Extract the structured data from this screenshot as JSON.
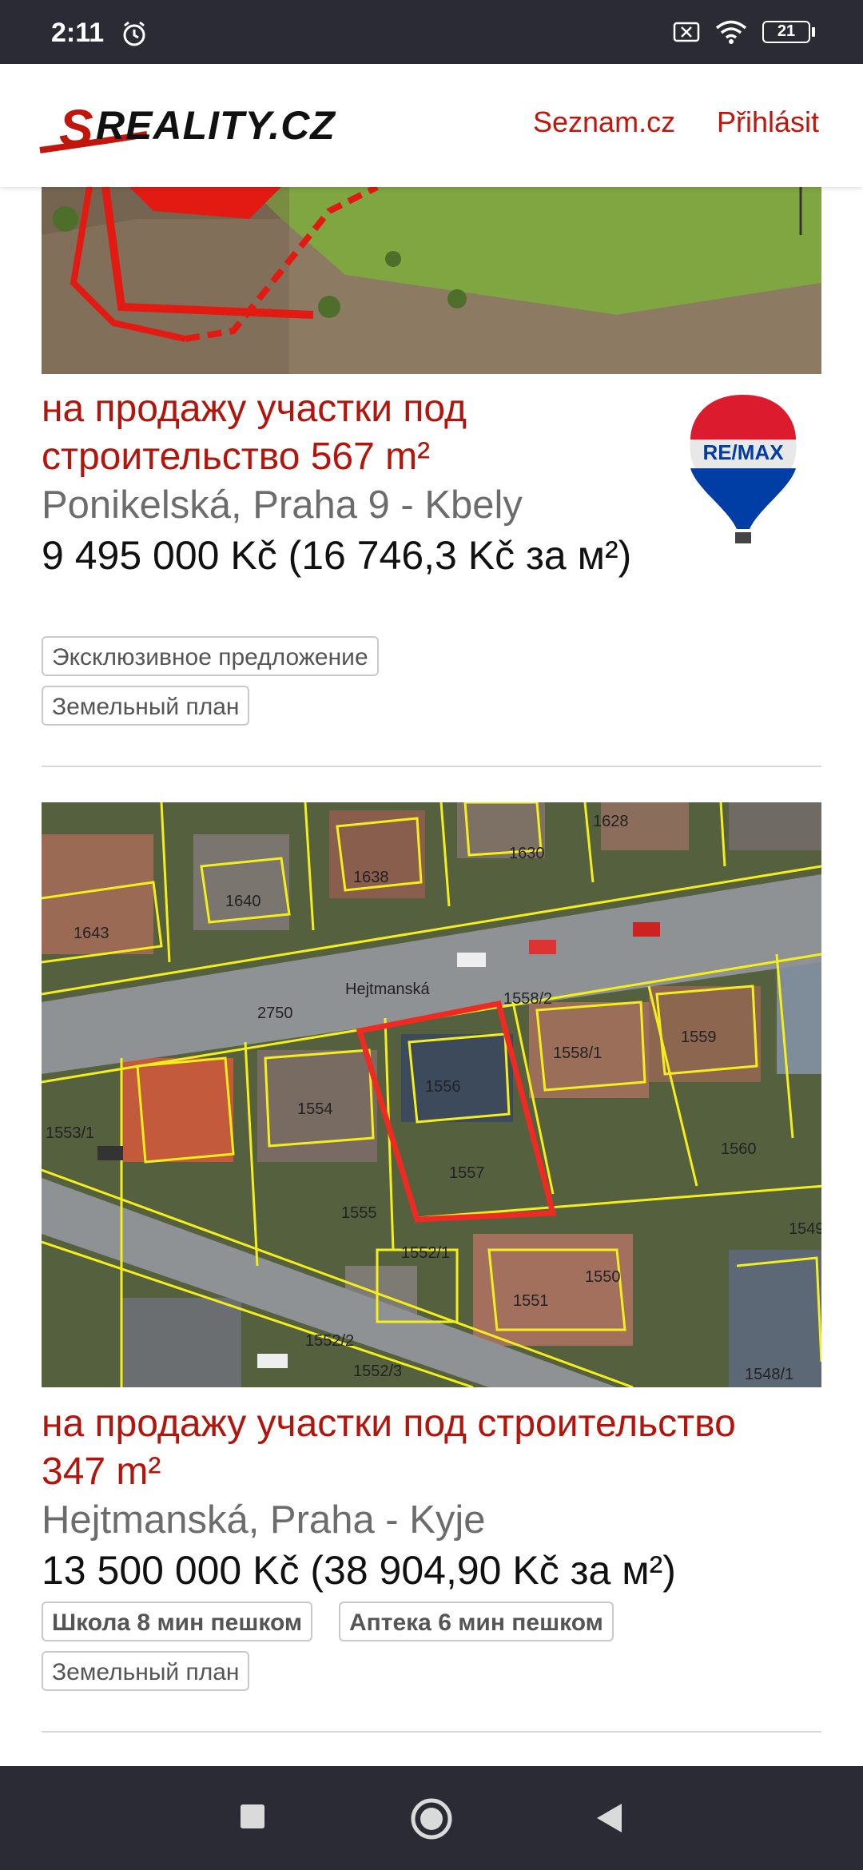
{
  "status_bar": {
    "time": "2:11",
    "battery": "21"
  },
  "header": {
    "logo_text": "SREALITY.CZ",
    "links": [
      "Seznam.cz",
      "Přihlásit"
    ]
  },
  "listings": [
    {
      "title": "на продажу участки под строительство",
      "area": "567 m²",
      "address": "Ponikelská, Praha 9 - Kbely",
      "price": "9 495 000 Kč (16 746,3 Kč за м²)",
      "agency_logo": "RE/MAX",
      "tags": [
        "Эксклюзивное предложение",
        "Земельный план"
      ]
    },
    {
      "title": "на продажу участки под строительство",
      "area": "347 m²",
      "address": "Hejtmanská, Praha - Kyje",
      "price": "13 500 000 Kč (38 904,90 Kč за м²)",
      "tags": [
        "Школа 8 мин пешком",
        "Аптека 6 мин пешком",
        "Земельный план"
      ],
      "map_labels": [
        "Hejtmanská",
        "2750",
        "1556",
        "1557",
        "1554",
        "1558/2",
        "1558/1",
        "1559",
        "1560",
        "1630",
        "1638",
        "1640",
        "1643",
        "1628",
        "1551",
        "1550",
        "1552/1",
        "1552/2",
        "1552/3",
        "1553/1",
        "1555",
        "1548/1",
        "1549"
      ]
    }
  ],
  "nav_bar": {
    "buttons": [
      "recent-apps",
      "home",
      "back"
    ]
  },
  "colors": {
    "brand_red": "#c2150c",
    "status_bar": "#2b2b35"
  }
}
